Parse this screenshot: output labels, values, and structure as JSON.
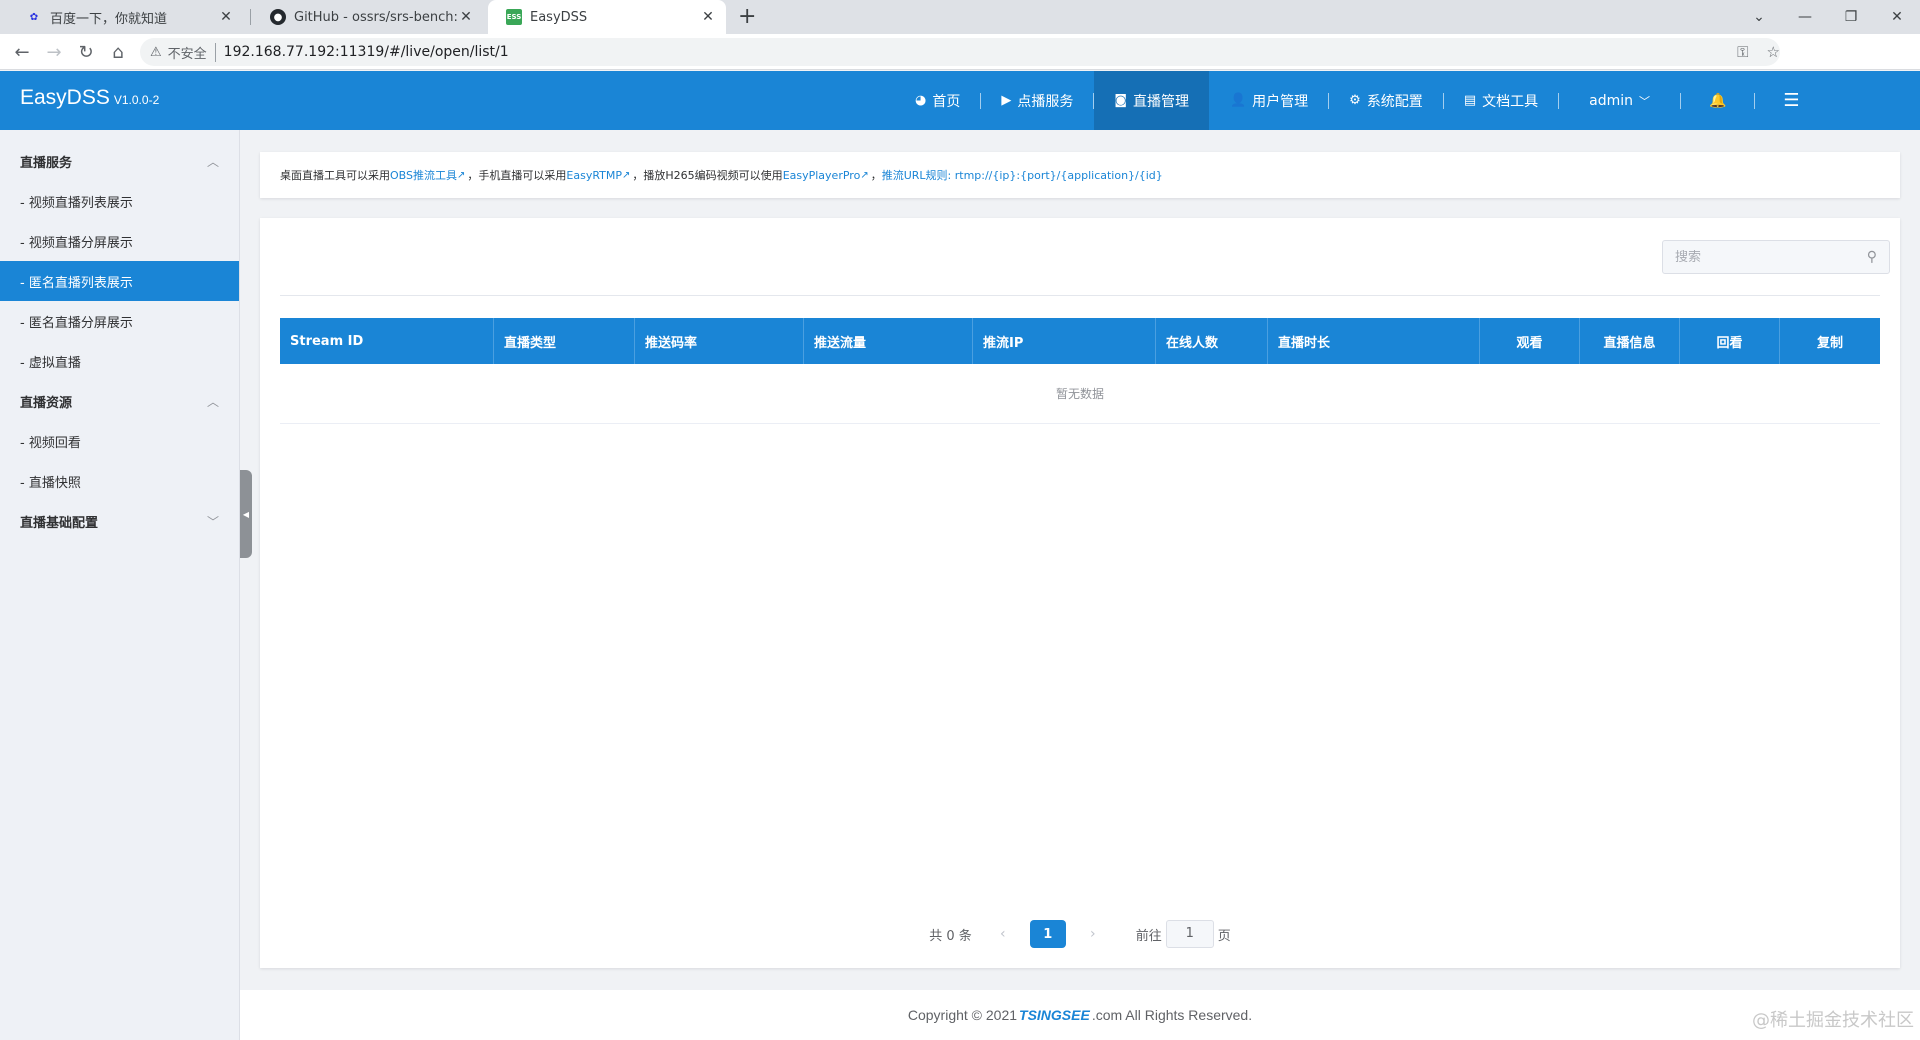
{
  "browser": {
    "tabs": [
      {
        "title": "百度一下，你就知道",
        "icon": "baidu-icon"
      },
      {
        "title": "GitHub - ossrs/srs-bench: SB(S",
        "icon": "github-icon"
      },
      {
        "title": "EasyDSS",
        "icon": "easydss-icon",
        "active": true
      }
    ],
    "insecure_label": "不安全",
    "url": "192.168.77.192:11319/#/live/open/list/1"
  },
  "app": {
    "brand": "EasyDSS",
    "version": "V1.0.0-2",
    "nav": [
      {
        "label": "首页",
        "icon": "dashboard-icon"
      },
      {
        "label": "点播服务",
        "icon": "video-camera-icon"
      },
      {
        "label": "直播管理",
        "icon": "camera-icon",
        "active": true
      },
      {
        "label": "用户管理",
        "icon": "user-icon"
      },
      {
        "label": "系统配置",
        "icon": "gear-icon"
      },
      {
        "label": "文档工具",
        "icon": "book-icon"
      }
    ],
    "user": "admin"
  },
  "sidebar": {
    "groups": [
      {
        "label": "直播服务",
        "items": [
          "- 视频直播列表展示",
          "- 视频直播分屏展示",
          "- 匿名直播列表展示",
          "- 匿名直播分屏展示",
          "- 虚拟直播"
        ]
      },
      {
        "label": "直播资源",
        "items": [
          "- 视频回看",
          "- 直播快照"
        ]
      },
      {
        "label": "直播基础配置",
        "items": []
      }
    ],
    "active_item": "- 匿名直播列表展示"
  },
  "notice": {
    "t1": "桌面直播工具可以采用 ",
    "l1": "OBS推流工具",
    "t2": "，手机直播可以采用 ",
    "l2": "EasyRTMP",
    "t3": "，播放H265编码视频可以使用 ",
    "l3": "EasyPlayerPro",
    "t4": "，",
    "l4": "推流URL规则: rtmp://{ip}:{port}/{application}/{id}"
  },
  "search": {
    "placeholder": "搜索"
  },
  "table": {
    "columns": [
      "Stream ID",
      "直播类型",
      "推送码率",
      "推送流量",
      "推流IP",
      "在线人数",
      "直播时长",
      "观看",
      "直播信息",
      "回看",
      "复制"
    ],
    "empty_text": "暂无数据"
  },
  "pagination": {
    "total_text": "共 0 条",
    "current_page": "1",
    "goto_label": "前往",
    "goto_value": "1",
    "page_suffix": "页"
  },
  "footer": {
    "prefix": "Copyright © 2021 ",
    "logo": "TSINGSEE",
    "suffix": ".com All Rights Reserved."
  },
  "watermark": "@稀土掘金技术社区",
  "colors": {
    "primary": "#1a85d6",
    "active_nav": "#156fb5",
    "sidebar_bg": "#eef1f6"
  }
}
